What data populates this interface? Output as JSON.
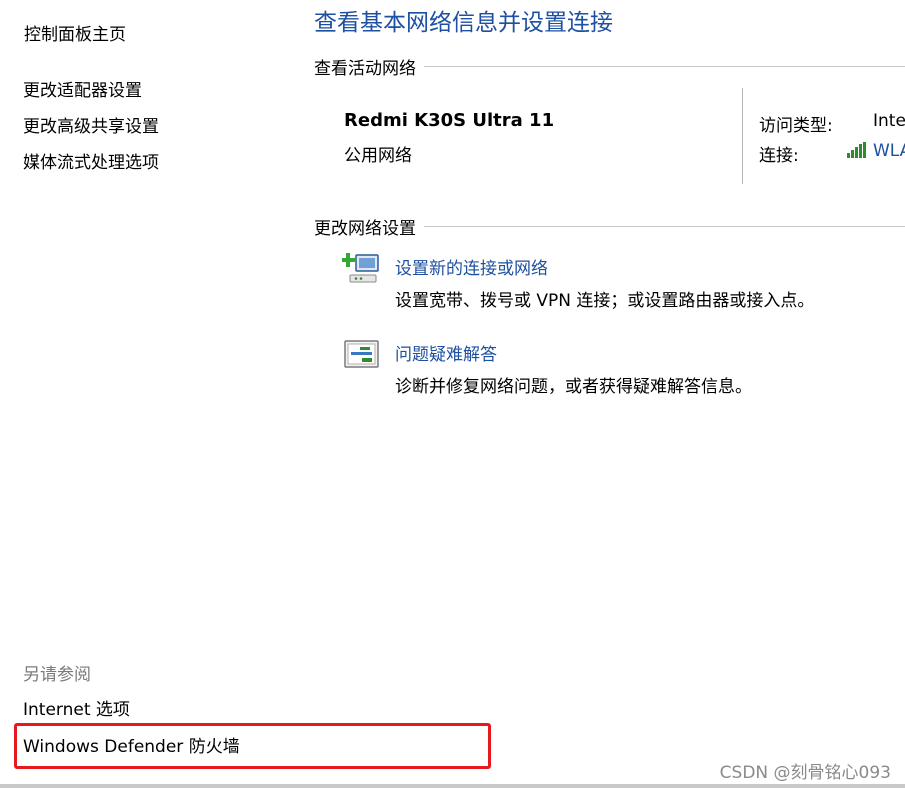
{
  "sidebar": {
    "home": "控制面板主页",
    "links": [
      "更改适配器设置",
      "更改高级共享设置",
      "媒体流式处理选项"
    ],
    "see_also_title": "另请参阅",
    "see_also_links": [
      "Internet 选项",
      "Windows Defender 防火墙"
    ]
  },
  "main": {
    "title": "查看基本网络信息并设置连接",
    "active_section": "查看活动网络",
    "network": {
      "name": "Redmi K30S Ultra 11",
      "type": "公用网络",
      "access_type_label": "访问类型:",
      "access_type_value": "Inte",
      "connection_label": "连接:",
      "connection_value": "WLA"
    },
    "change_section": "更改网络设置",
    "tasks": [
      {
        "icon": "new-connection-icon",
        "title": "设置新的连接或网络",
        "desc": "设置宽带、拨号或 VPN 连接；或设置路由器或接入点。"
      },
      {
        "icon": "troubleshoot-icon",
        "title": "问题疑难解答",
        "desc": "诊断并修复网络问题，或者获得疑难解答信息。"
      }
    ]
  },
  "watermark": "CSDN @刻骨铭心093",
  "colors": {
    "link": "#1e50a2",
    "highlight": "#e8191e",
    "muted": "#7a7a7a"
  }
}
